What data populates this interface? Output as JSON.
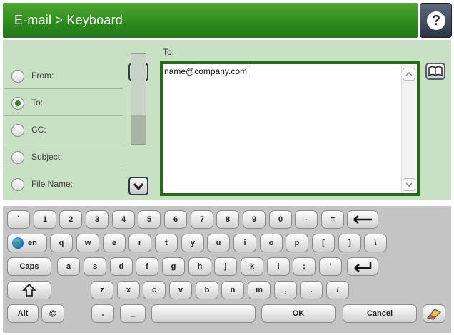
{
  "header": {
    "title": "E-mail > Keyboard",
    "help_icon": "question-mark-icon"
  },
  "fields": [
    {
      "label": "From:",
      "selected": false
    },
    {
      "label": "To:",
      "selected": true
    },
    {
      "label": "CC:",
      "selected": false
    },
    {
      "label": "Subject:",
      "selected": false
    },
    {
      "label": "File Name:",
      "selected": false
    }
  ],
  "to_field": {
    "label": "To:",
    "value": "name@company.com"
  },
  "keyboard": {
    "row1": [
      "`",
      "1",
      "2",
      "3",
      "4",
      "5",
      "6",
      "7",
      "8",
      "9",
      "0",
      "-",
      "="
    ],
    "row2": [
      "q",
      "w",
      "e",
      "r",
      "t",
      "y",
      "u",
      "i",
      "o",
      "p",
      "[",
      "]",
      "\\"
    ],
    "row3": [
      "a",
      "s",
      "d",
      "f",
      "g",
      "h",
      "j",
      "k",
      "l",
      ";",
      "'"
    ],
    "row4": [
      "z",
      "x",
      "c",
      "v",
      "b",
      "n",
      "m",
      ",",
      ".",
      "/"
    ],
    "language_label": "en",
    "caps_label": "Caps",
    "alt_label": "Alt",
    "at_label": "@",
    "dot_label": ".",
    "underscore_label": "_",
    "ok_label": "OK",
    "cancel_label": "Cancel"
  },
  "colors": {
    "header_green": "#2b8a1c",
    "panel_green": "#c8e0c4",
    "keyboard_gray": "#c4c4c4",
    "focus_border": "#1f6f12"
  }
}
